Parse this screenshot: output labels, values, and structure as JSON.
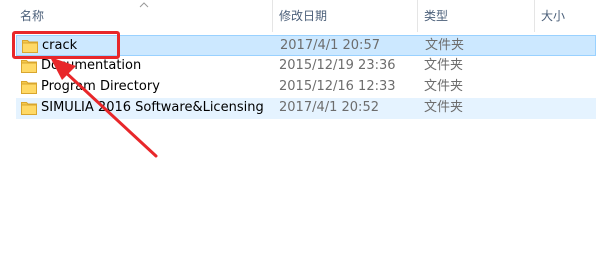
{
  "columns": {
    "name": "名称",
    "date": "修改日期",
    "type": "类型",
    "size": "大小"
  },
  "files": [
    {
      "name": "crack",
      "date": "2017/4/1 20:57",
      "type": "文件夹",
      "icon": "folder-icon",
      "state": "selected"
    },
    {
      "name": "Documentation",
      "date": "2015/12/19 23:36",
      "type": "文件夹",
      "icon": "folder-icon",
      "state": "normal"
    },
    {
      "name": "Program Directory",
      "date": "2015/12/16 12:33",
      "type": "文件夹",
      "icon": "folder-icon",
      "state": "normal"
    },
    {
      "name": "SIMULIA 2016 Software&Licensing",
      "date": "2017/4/1 20:52",
      "type": "文件夹",
      "icon": "folder-icon",
      "state": "hover"
    }
  ],
  "colors": {
    "selected_bg": "#cce8ff",
    "hover_bg": "#e5f3ff",
    "annotation": "#e8272a",
    "folder": "#f5c94c"
  }
}
